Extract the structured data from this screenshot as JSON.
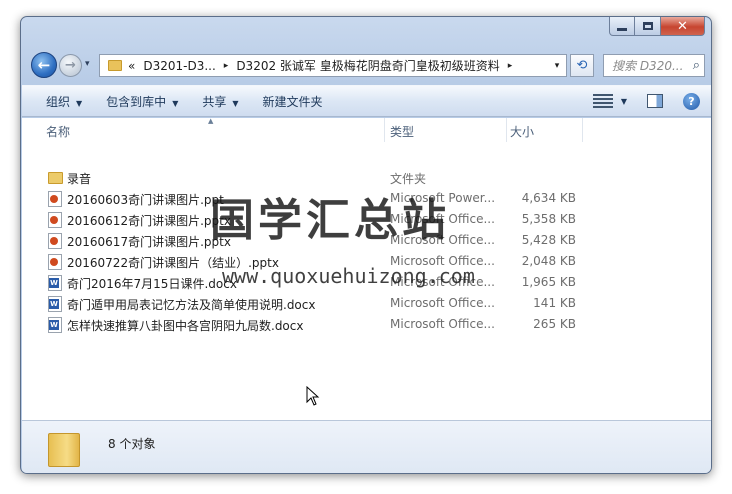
{
  "window": {
    "caption": {
      "minimize": "–",
      "close": "✕"
    }
  },
  "nav": {
    "back_glyph": "←",
    "forward_glyph": "→",
    "recent_glyph": "▾",
    "breadcrumb": [
      "«",
      "D3201-D3...",
      "D3202 张诚军 皇极梅花阴盘奇门皇极初级班资料"
    ],
    "crumb_sep": "▸",
    "address_dropdown": "▾",
    "refresh_glyph": "⟲",
    "search_placeholder": "搜索 D320...",
    "search_icon": "⌕"
  },
  "toolbar": {
    "organize": "组织",
    "include_in_library": "包含到库中",
    "share": "共享",
    "new_folder": "新建文件夹",
    "arrow": "▼",
    "help": "?"
  },
  "columns": {
    "name": "名称",
    "type": "类型",
    "size": "大小",
    "sort_caret": "▲"
  },
  "files": [
    {
      "name": "录音",
      "type": "文件夹",
      "size": "",
      "icon": "folder-icon"
    },
    {
      "name": "20160603奇门讲课图片.ppt",
      "type": "Microsoft Power...",
      "size": "4,634 KB",
      "icon": "powerpoint-icon"
    },
    {
      "name": "20160612奇门讲课图片.pptx",
      "type": "Microsoft Office...",
      "size": "5,358 KB",
      "icon": "powerpoint-icon"
    },
    {
      "name": "20160617奇门讲课图片.pptx",
      "type": "Microsoft Office...",
      "size": "5,428 KB",
      "icon": "powerpoint-icon"
    },
    {
      "name": "20160722奇门讲课图片（结业）.pptx",
      "type": "Microsoft Office...",
      "size": "2,048 KB",
      "icon": "powerpoint-icon"
    },
    {
      "name": "奇门2016年7月15日课件.docx",
      "type": "Microsoft Office...",
      "size": "1,965 KB",
      "icon": "word-icon"
    },
    {
      "name": "奇门遁甲用局表记忆方法及简单使用说明.docx",
      "type": "Microsoft Office...",
      "size": "141 KB",
      "icon": "word-icon"
    },
    {
      "name": "怎样快速推算八卦图中各宫阴阳九局数.docx",
      "type": "Microsoft Office...",
      "size": "265 KB",
      "icon": "word-icon"
    }
  ],
  "watermark": {
    "title": "国学汇总站",
    "url": "www.quoxuehuizong.com"
  },
  "details": {
    "item_count": "8 个对象"
  }
}
